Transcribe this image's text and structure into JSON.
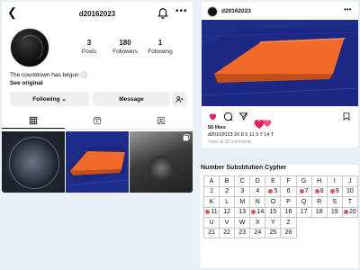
{
  "profile": {
    "back_icon": "chevron-left-icon",
    "username": "d20162023",
    "bell_icon": "bell-icon",
    "more_label": "•••",
    "stats": [
      {
        "value": "3",
        "label": "Posts"
      },
      {
        "value": "180",
        "label": "Followers"
      },
      {
        "value": "1",
        "label": "Following"
      }
    ],
    "bio": "The countdown has begun 🕓",
    "see_original": "See original",
    "following_button": "Following ⌄",
    "message_button": "Message",
    "add_user_icon": "add-user-icon",
    "tabs": [
      "grid-icon",
      "reels-icon",
      "tagged-icon"
    ],
    "grid_items": [
      "ball-photo",
      "court-image",
      "dark-photo"
    ]
  },
  "post": {
    "username": "d20162023",
    "more_label": "•••",
    "likes": "50 likes",
    "caption": "d20162023 20 8 5 11 9 7 14 T",
    "comments": "View all 18 comments",
    "actions": [
      "heart-icon",
      "comment-icon",
      "share-icon",
      "bookmark-icon"
    ]
  },
  "cipher": {
    "title": "Number Substitution Cypher",
    "rows": [
      {
        "letters": [
          "A",
          "B",
          "C",
          "D",
          "E",
          "F",
          "G",
          "H",
          "I",
          "J"
        ],
        "numbers": [
          "1",
          "2",
          "3",
          "4",
          "•5",
          "6",
          "•7",
          "•8",
          "•9",
          "10"
        ]
      },
      {
        "letters": [
          "K",
          "L",
          "M",
          "N",
          "O",
          "P",
          "Q",
          "R",
          "S",
          "T"
        ],
        "numbers": [
          "•11",
          "12",
          "13",
          "•14",
          "15",
          "16",
          "17",
          "18",
          "19",
          "•20"
        ]
      },
      {
        "letters": [
          "U",
          "V",
          "W",
          "X",
          "Y",
          "Z"
        ],
        "numbers": [
          "21",
          "22",
          "23",
          "24",
          "25",
          "26"
        ]
      }
    ],
    "highlight_color": "#e05561"
  },
  "colors": {
    "court_orange": "#f26a2a",
    "court_blue": "#1e2d8a",
    "heart_red": "#e0245e"
  }
}
